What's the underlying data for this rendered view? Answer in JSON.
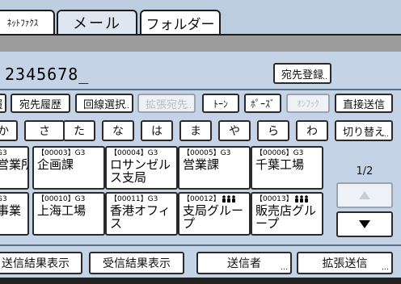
{
  "tabs": [
    {
      "label": "ﾈｯﾄﾌｧｸｽ",
      "active": false
    },
    {
      "label": "メール",
      "active": true
    },
    {
      "label": "フォルダー",
      "active": false
    }
  ],
  "destination_number": "2345678_",
  "register_button": "宛先登録",
  "row1": {
    "cut_left": "履",
    "history": "宛先履歴",
    "line_select": "回線選択",
    "extended_dest": "拡張宛先",
    "tone": "ﾄｰﾝ",
    "pause": "ﾎﾟｰｽﾞ",
    "on_hook": "ｵﾝﾌｯｸ",
    "direct_send": "直接送信"
  },
  "kana_keys": [
    "か",
    "さ",
    "た",
    "な",
    "は",
    "ま",
    "や",
    "ら",
    "わ"
  ],
  "switch_button": "切り替え",
  "address_rows": [
    [
      {
        "code": "G3",
        "name": "営業所"
      },
      {
        "code": "【00003】G3",
        "name": "企画課"
      },
      {
        "code": "【00004】G3",
        "name": "ロサンゼルス支局"
      },
      {
        "code": "【00005】G3",
        "name": "営業課"
      },
      {
        "code": "【00006】G3",
        "name": "千葉工場"
      }
    ],
    [
      {
        "code": "G3",
        "name": "事業"
      },
      {
        "code": "【00010】G3",
        "name": "上海工場"
      },
      {
        "code": "【00011】G3",
        "name": "香港オフィス"
      },
      {
        "code": "【00012】",
        "name": "支局グループ",
        "group": true
      },
      {
        "code": "【00013】",
        "name": "販売店グループ",
        "group": true
      }
    ]
  ],
  "page_indicator": "1/2",
  "bottom_buttons": {
    "send_result": "送信結果表示",
    "recv_result": "受信結果表示",
    "sender": "送信者",
    "extended_send": "拡張送信"
  },
  "colors": {
    "background": "#c4d4e6",
    "button": "#ffffff",
    "border": "#2a2a2a"
  },
  "icons": {
    "up": "up-arrow-icon",
    "down": "down-arrow-icon",
    "group": "group-people-icon"
  }
}
